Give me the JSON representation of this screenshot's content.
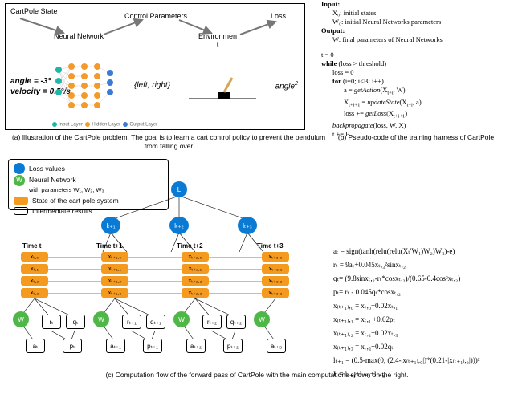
{
  "panel_a": {
    "labels": {
      "state_title": "CartPole State",
      "nn": "Neural Network",
      "control": "Control Parameters",
      "env_line1": "Environmen",
      "env_line2": "t",
      "loss": "Loss",
      "state_1": "angle = -3°",
      "state_2": "velocity = 0.5°/s",
      "action_set": "{left, right}",
      "loss_expr_base": "angle",
      "loss_expr_sup": "2",
      "nn_legend_input": "Input Layer",
      "nn_legend_hidden": "Hidden Layer",
      "nn_legend_output": "Output Layer"
    },
    "caption": "(a) Illustration of the CartPole problem. The goal is to learn a cart control policy to prevent the pendulum from falling over"
  },
  "panel_b": {
    "input_hdr": "Input:",
    "x0": "X₀: initial states",
    "w0": "W₀: initial Neural Networks parameters",
    "output_hdr": "Output:",
    "w_out": "W: final parameters of Neural Networks",
    "line_t0": "t = 0",
    "line_while": "while (loss > threshold)",
    "line_loss0": "loss = 0",
    "line_for": "for (i=0; i<B; i++)",
    "line_a": "a = getAction(Xt+i, W)",
    "line_xupd": "Xt+i+1 = updateState(Xt+i, a)",
    "line_lossadd": "loss += getLoss(Xt+i+1)",
    "line_bp": "backpropagate(loss, W, X)",
    "line_tB": "t += B",
    "caption": "(b) Pseudo-code of the training harness of CartPole"
  },
  "panel_c": {
    "legend": {
      "loss": "Loss values",
      "nn_line1": "Neural  Network",
      "nn_line2": "with parameters W₁, W₂, W₃",
      "state": "State of the cart pole system",
      "inter": "Intermediate results"
    },
    "time_labels": [
      "Time t",
      "Time t+1",
      "Time t+2",
      "Time t+3"
    ],
    "top_L": "L",
    "loss_nodes": [
      "lₜ₊₁",
      "lₜ₊₂",
      "lₜ₊₃"
    ],
    "w_label": "W",
    "state_labels": [
      [
        "xₜ,₀",
        "xₜ,₁",
        "xₜ,₂",
        "xₜ,₃"
      ],
      [
        "xₜ₊₁,₀",
        "xₜ₊₁,₁",
        "xₜ₊₁,₂",
        "xₜ₊₁,₃"
      ],
      [
        "xₜ₊₂,₀",
        "xₜ₊₂,₁",
        "xₜ₊₂,₂",
        "xₜ₊₂,₃"
      ],
      [
        "xₜ₊₃,₀",
        "xₜ₊₃,₁",
        "xₜ₊₃,₂",
        "xₜ₊₃,₃"
      ]
    ],
    "inter_rows": [
      [
        "rₜ",
        "qₜ",
        "rₜ₊₁",
        "qₜ₊₁",
        "rₜ₊₂",
        "qₜ₊₂"
      ],
      [
        "aₜ",
        "pₜ",
        "aₜ₊₁",
        "pₜ₊₁",
        "aₜ₊₂",
        "pₜ₊₂",
        "aₜ₊₃"
      ]
    ],
    "math": [
      "aₜ = sign(tanh(relu(relu(Xₜ'W₁)W₂)W₃)-e)",
      "rₜ = 9aₜ+0.045xₜ,₃²sinxₜ,₂",
      "qₜ= (9.8sinxₜ,₂-rₜ*cosxₜ,₂)/(0.65-0.4cos²xₜ,₂)",
      "pₜ= rₜ - 0.045qₜ*cosxₜ,₂",
      "x₍ₜ₊₁₎,₀ = xₜ,₀+0.02xₜ,₁",
      "x₍ₜ₊₁₎,₁ = xₜ,₁ +0.02pₜ",
      "x₍ₜ₊₁₎,₂ = xₜ,₂+0.02xₜ,₃",
      "x₍ₜ₊₁₎,₃ = xₜ,₃+0.02qₜ",
      "lₜ₊₁ = (0.5-max(0, (2.4-|x₍ₜ₊₁₎,₀|)*(0.21-|x₍ₜ₊₁₎,₂|)))²",
      "L = lₜ₊₁+lₜ₊₂+lₜ₊₃"
    ],
    "caption": "(c) Computation flow of the forward pass of CartPole with the main computations shown on the right."
  },
  "chart_data": {
    "type": "diagram",
    "panel_a_flow_nodes": [
      "CartPole State",
      "Neural Network",
      "Control Parameters",
      "Environment",
      "Loss"
    ],
    "panel_a_flow_edges": [
      [
        "CartPole State",
        "Neural Network"
      ],
      [
        "Neural Network",
        "Control Parameters"
      ],
      [
        "Control Parameters",
        "Environment"
      ],
      [
        "Environment",
        "Loss"
      ]
    ],
    "panel_c_graph": {
      "top": "L",
      "loss_nodes": [
        "l_{t+1}",
        "l_{t+2}",
        "l_{t+3}"
      ],
      "time_columns": [
        "t",
        "t+1",
        "t+2",
        "t+3"
      ],
      "state_vec_per_column": [
        "x_{·,0}",
        "x_{·,1}",
        "x_{·,2}",
        "x_{·,3}"
      ],
      "w_nodes_count": 4,
      "intermediate_row1": [
        "r_t",
        "q_t",
        "r_{t+1}",
        "q_{t+1}",
        "r_{t+2}",
        "q_{t+2}"
      ],
      "intermediate_row2": [
        "a_t",
        "p_t",
        "a_{t+1}",
        "p_{t+1}",
        "a_{t+2}",
        "p_{t+2}",
        "a_{t+3}"
      ],
      "edges_description": "L aggregates l_{t+1..t+3}; each l depends on next-column state; each next state depends on prior state + r,q,p,a; a depends on W + current state; r,q,p depend on a and state."
    }
  }
}
